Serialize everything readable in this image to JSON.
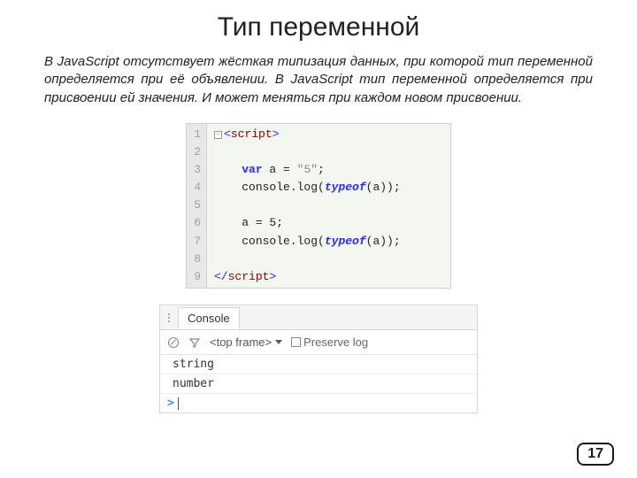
{
  "title": "Тип переменной",
  "paragraph_parts": {
    "p1": "В ",
    "js1": "JavaScript",
    "p2": " отсутствует жёсткая типизация данных, при которой тип переменной определяется при её объявлении. В ",
    "js2": "JavaScript",
    "p3": " тип переменной определяется при присвоении ей значения. И может меняться при каждом новом присвоении."
  },
  "code": {
    "line_numbers": [
      "1",
      "2",
      "3",
      "4",
      "5",
      "6",
      "7",
      "8",
      "9"
    ],
    "l1_open_angle": "<",
    "l1_tag": "script",
    "l1_close_angle": ">",
    "l3_indent": "    ",
    "l3_var": "var",
    "l3_rest": " a = ",
    "l3_str": "\"5\"",
    "l3_semi": ";",
    "l4_indent": "    ",
    "l4_a": "console.log(",
    "l4_typeof": "typeof",
    "l4_b": "(a));",
    "l6_indent": "    ",
    "l6": "a = 5;",
    "l7_indent": "    ",
    "l7_a": "console.log(",
    "l7_typeof": "typeof",
    "l7_b": "(a));",
    "l9_open_angle": "</",
    "l9_tag": "script",
    "l9_close_angle": ">"
  },
  "console": {
    "tab": "Console",
    "frame": "<top frame>",
    "preserve": "Preserve log",
    "out1": "string",
    "out2": "number",
    "prompt": ">"
  },
  "page_number": "17"
}
